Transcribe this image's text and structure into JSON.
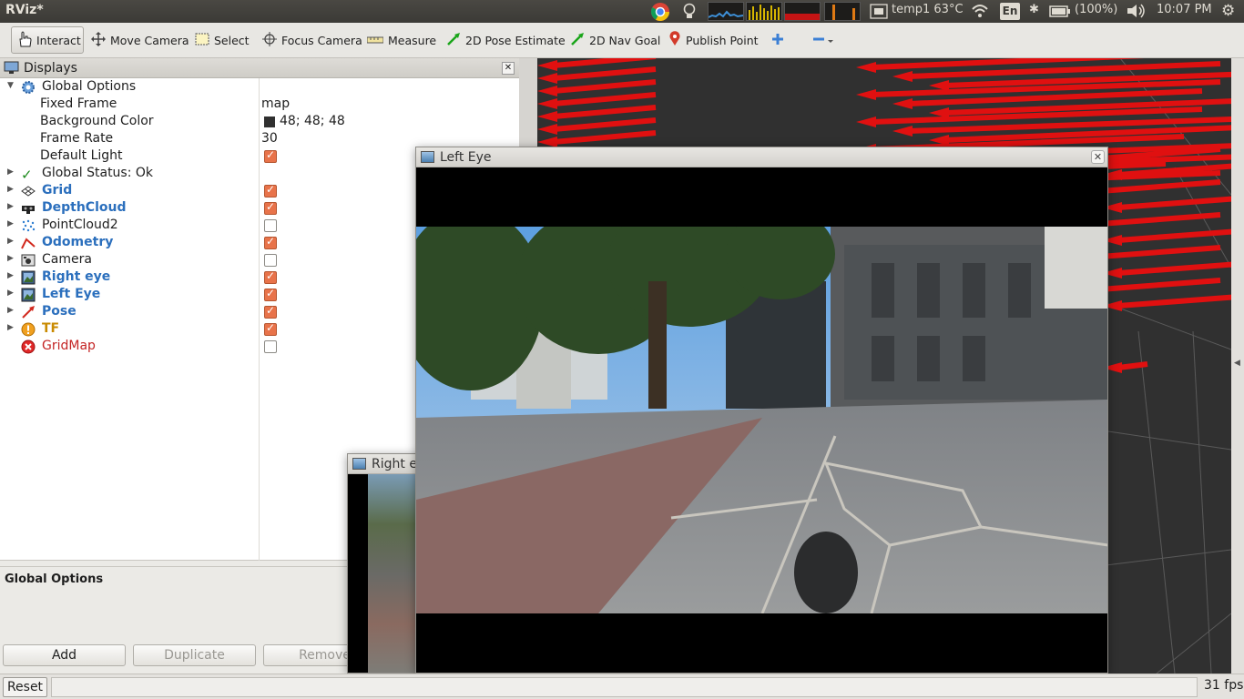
{
  "window": {
    "title": "RViz*"
  },
  "tray": {
    "temperature": "temp1 63°C",
    "keyboard": "En",
    "battery": "(100%)",
    "clock": "10:07 PM"
  },
  "toolbar": {
    "tools": [
      {
        "label": "Interact",
        "icon": "hand-icon"
      },
      {
        "label": "Move Camera",
        "icon": "move-camera-icon"
      },
      {
        "label": "Select",
        "icon": "select-icon"
      },
      {
        "label": "Focus Camera",
        "icon": "focus-camera-icon"
      },
      {
        "label": "Measure",
        "icon": "ruler-icon"
      },
      {
        "label": "2D Pose Estimate",
        "icon": "pose-arrow-icon"
      },
      {
        "label": "2D Nav Goal",
        "icon": "nav-goal-icon"
      },
      {
        "label": "Publish Point",
        "icon": "map-pin-icon"
      }
    ]
  },
  "displays": {
    "title": "Displays",
    "global_options": {
      "label": "Global Options",
      "fixed_frame_label": "Fixed Frame",
      "fixed_frame_value": "map",
      "bg_color_label": "Background Color",
      "bg_color_value": "48; 48; 48",
      "bg_color_hex": "#303030",
      "frame_rate_label": "Frame Rate",
      "frame_rate_value": "30",
      "default_light_label": "Default Light",
      "default_light_checked": true
    },
    "items": [
      {
        "label": "Global Status: Ok",
        "checkbox": null
      },
      {
        "label": "Grid",
        "checked": true
      },
      {
        "label": "DepthCloud",
        "checked": true
      },
      {
        "label": "PointCloud2",
        "checked": false
      },
      {
        "label": "Odometry",
        "checked": true
      },
      {
        "label": "Camera",
        "checked": false
      },
      {
        "label": "Right eye",
        "checked": true
      },
      {
        "label": "Left Eye",
        "checked": true
      },
      {
        "label": "Pose",
        "checked": true
      },
      {
        "label": "TF",
        "checked": true
      },
      {
        "label": "GridMap",
        "checked": false
      }
    ],
    "description_title": "Global Options",
    "buttons": {
      "add": "Add",
      "duplicate": "Duplicate",
      "remove": "Remove"
    }
  },
  "windows": {
    "left_eye": {
      "title": "Left Eye"
    },
    "right_eye": {
      "title": "Right e"
    }
  },
  "bottom": {
    "reset": "Reset",
    "fps": "31 fps"
  },
  "colors": {
    "accent_checkbox": "#e8734a",
    "arrows": "#e01010",
    "view_bg": "#303030"
  }
}
